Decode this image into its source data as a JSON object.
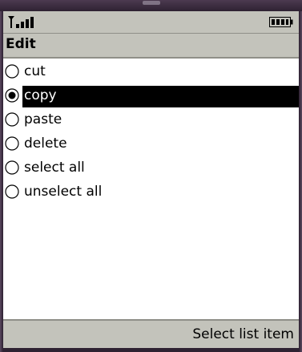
{
  "title": "Edit",
  "list": {
    "items": [
      {
        "label": "cut",
        "selected": false
      },
      {
        "label": "copy",
        "selected": true
      },
      {
        "label": "paste",
        "selected": false
      },
      {
        "label": "delete",
        "selected": false
      },
      {
        "label": "select all",
        "selected": false
      },
      {
        "label": "unselect all",
        "selected": false
      }
    ]
  },
  "softkey": {
    "right_label": "Select list item"
  },
  "icons": {
    "signal": "signal-strength-icon",
    "battery": "battery-icon",
    "radio": "radio-button-icon"
  },
  "colors": {
    "bar": "#c3c3bb",
    "highlight": "#000000",
    "background": "#ffffff"
  }
}
